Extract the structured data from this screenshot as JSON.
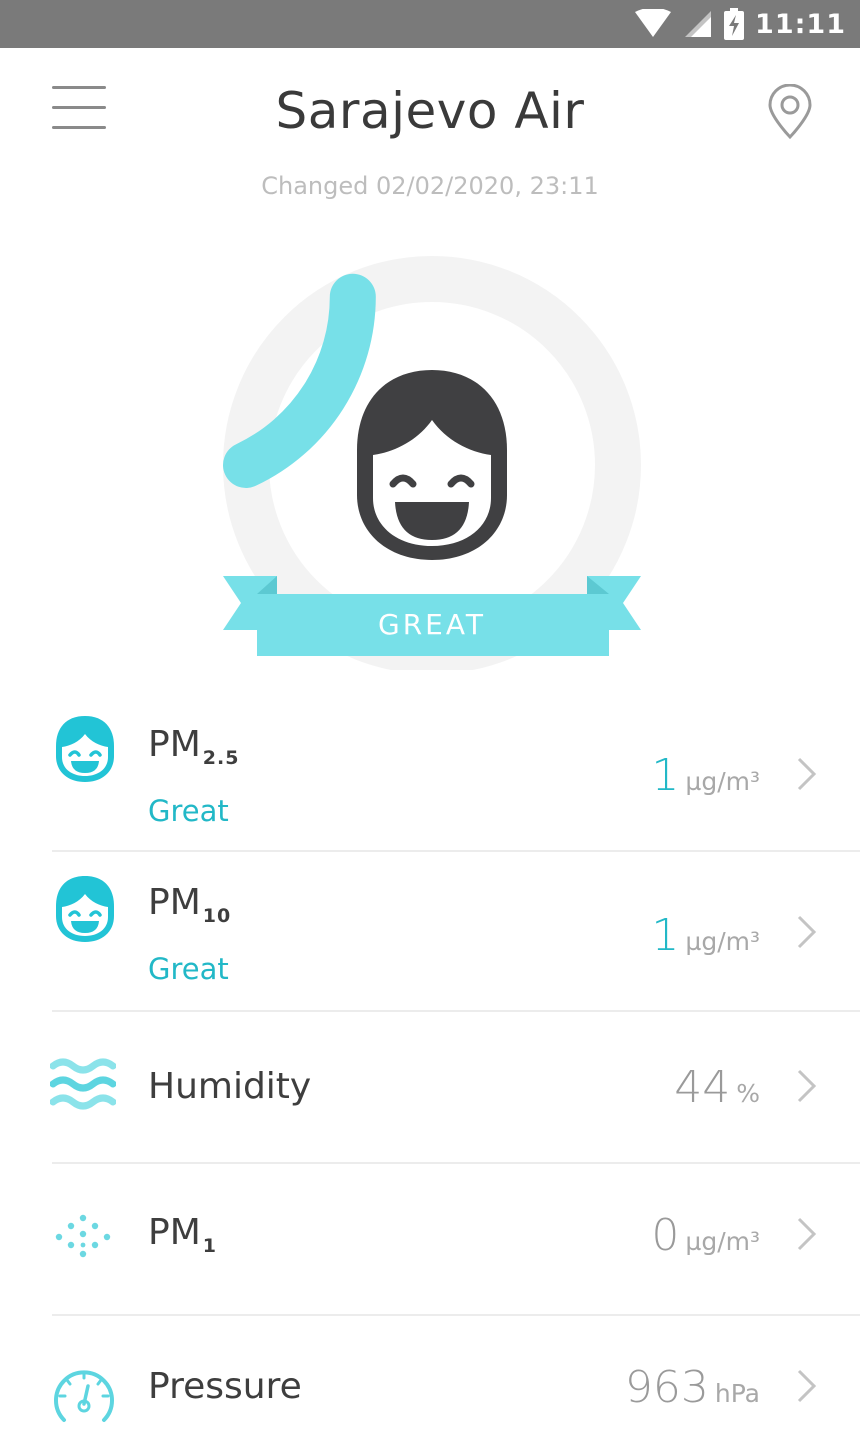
{
  "status_bar": {
    "time": "11:11"
  },
  "header": {
    "title": "Sarajevo Air",
    "subtitle": "Changed 02/02/2020, 23:11"
  },
  "gauge": {
    "quality_label": "GREAT",
    "level_fraction": 0.18,
    "accent_color": "#77e0e8",
    "face_icon": "happy-face-icon"
  },
  "metrics": [
    {
      "name": "PM",
      "sub": "2.5",
      "status": "Great",
      "value": "1",
      "unit": "µg/m³",
      "icon": "happy-face-icon"
    },
    {
      "name": "PM",
      "sub": "10",
      "status": "Great",
      "value": "1",
      "unit": "µg/m³",
      "icon": "happy-face-icon"
    },
    {
      "name": "Humidity",
      "sub": "",
      "status": "",
      "value": "44",
      "unit": "%",
      "icon": "waves-icon"
    },
    {
      "name": "PM",
      "sub": "1",
      "status": "",
      "value": "0",
      "unit": "µg/m³",
      "icon": "dots-icon"
    },
    {
      "name": "Pressure",
      "sub": "",
      "status": "",
      "value": "963",
      "unit": "hPa",
      "icon": "gauge-icon"
    }
  ],
  "colors": {
    "teal": "#22b8c7",
    "light_teal": "#77e0e8",
    "status_bar": "#7a7a7a"
  }
}
